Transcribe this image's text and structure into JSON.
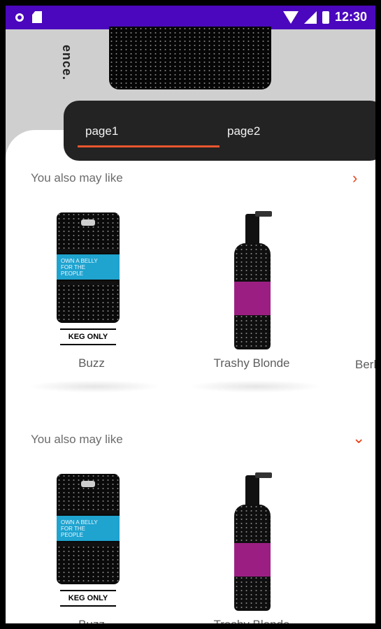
{
  "status_bar": {
    "time": "12:30",
    "icons": [
      "circle-indicator-icon",
      "sd-card-icon",
      "wifi-icon",
      "signal-icon",
      "battery-icon"
    ]
  },
  "hero": {
    "vertical_text": "ence."
  },
  "tabs": [
    {
      "label": "page1",
      "selected": true
    },
    {
      "label": "page2",
      "selected": false
    }
  ],
  "sections": [
    {
      "title": "You also may like",
      "toggle_icon": "chevron-right-icon",
      "toggle_glyph": "›",
      "items": [
        {
          "name": "Buzz",
          "type": "keg",
          "keg_band_text": "OWN A BELLY\nFOR THE\nPEOPLE",
          "keg_label": "KEG ONLY"
        },
        {
          "name": "Trashy Blonde",
          "type": "bottle"
        },
        {
          "name": "Berl",
          "type": "clipped"
        }
      ]
    },
    {
      "title": "You also may like",
      "toggle_icon": "chevron-down-icon",
      "toggle_glyph": "⌄",
      "items": [
        {
          "name": "Buzz",
          "type": "keg",
          "keg_band_text": "OWN A BELLY\nFOR THE\nPEOPLE",
          "keg_label": "KEG ONLY"
        },
        {
          "name": "Trashy Blonde",
          "type": "bottle"
        }
      ]
    }
  ],
  "colors": {
    "status_bar": "#4a07bd",
    "accent": "#e9552e",
    "tab_bar": "#232323",
    "keg_band": "#1fa3cf",
    "bottle_label": "#9b1f82"
  }
}
